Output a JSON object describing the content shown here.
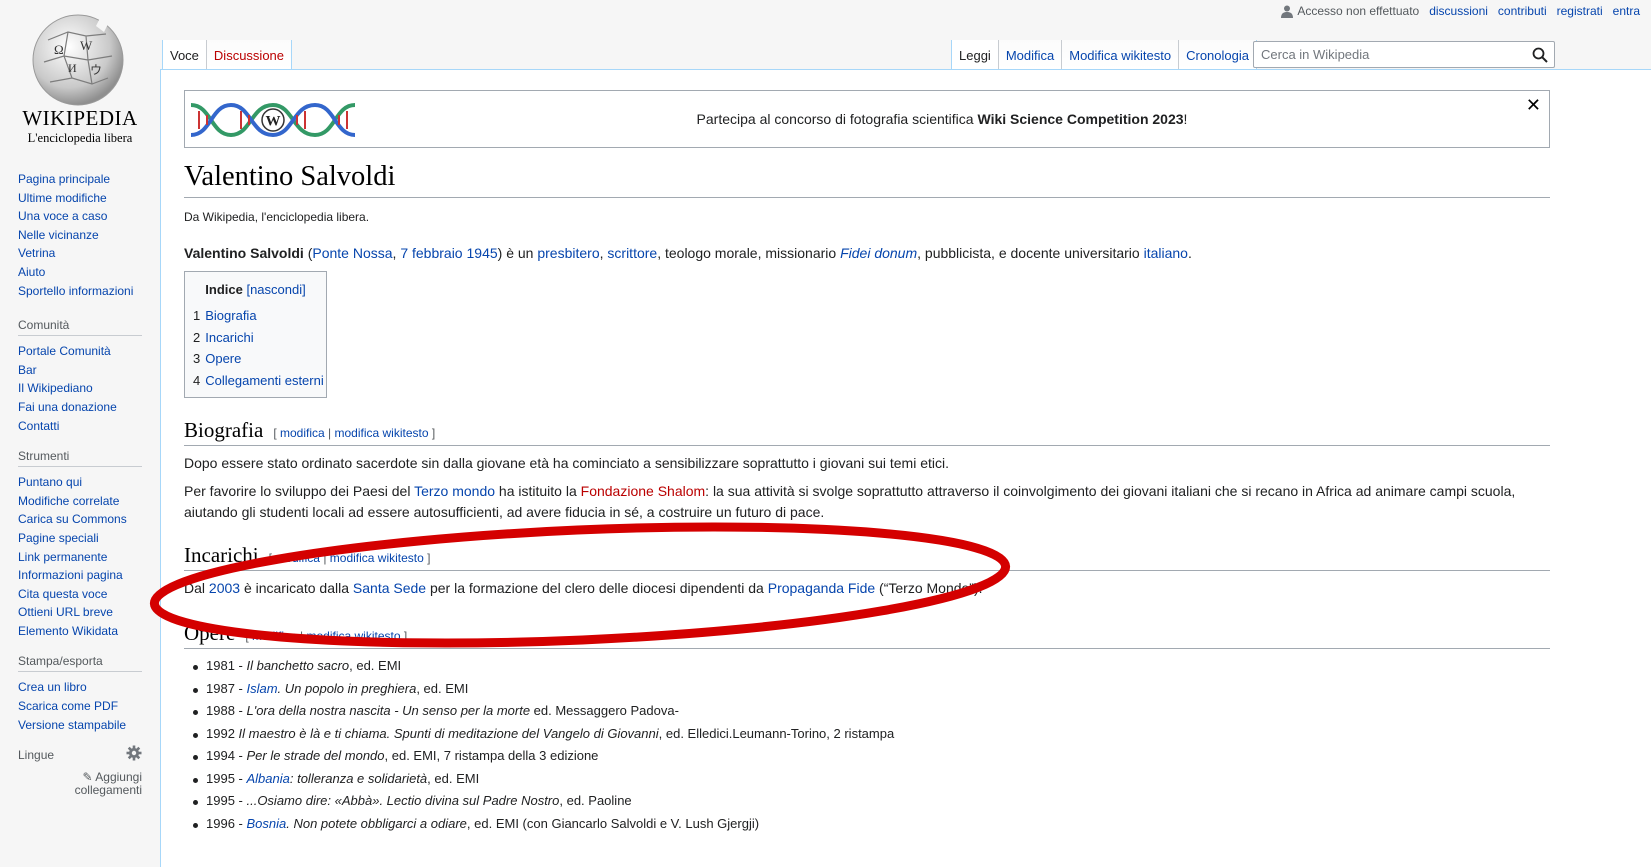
{
  "logo": {
    "wordmark": "WIKIPEDIA",
    "tagline": "L'enciclopedia libera"
  },
  "personal": {
    "anon": "Accesso non effettuato",
    "links": [
      "discussioni",
      "contributi",
      "registrati",
      "entra"
    ]
  },
  "tabs": {
    "left": [
      "Voce",
      "Discussione"
    ],
    "right": [
      "Leggi",
      "Modifica",
      "Modifica wikitesto",
      "Cronologia"
    ]
  },
  "search": {
    "placeholder": "Cerca in Wikipedia"
  },
  "sidebar": {
    "nav": [
      "Pagina principale",
      "Ultime modifiche",
      "Una voce a caso",
      "Nelle vicinanze",
      "Vetrina",
      "Aiuto",
      "Sportello informazioni"
    ],
    "community": {
      "heading": "Comunità",
      "items": [
        "Portale Comunità",
        "Bar",
        "Il Wikipediano",
        "Fai una donazione",
        "Contatti"
      ]
    },
    "tools": {
      "heading": "Strumenti",
      "items": [
        "Puntano qui",
        "Modifiche correlate",
        "Carica su Commons",
        "Pagine speciali",
        "Link permanente",
        "Informazioni pagina",
        "Cita questa voce",
        "Ottieni URL breve",
        "Elemento Wikidata"
      ]
    },
    "print": {
      "heading": "Stampa/esporta",
      "items": [
        "Crea un libro",
        "Scarica come PDF",
        "Versione stampabile"
      ]
    },
    "languages": {
      "heading": "Lingue",
      "add_links_1": "Aggiungi",
      "add_links_2": "collegamenti"
    }
  },
  "banner": {
    "text": "Partecipa al concorso di fotografia scientifica ",
    "bold": "Wiki Science Competition 2023",
    "after": "!",
    "close": "✕"
  },
  "article": {
    "title": "Valentino Salvoldi",
    "site_sub": "Da Wikipedia, l'enciclopedia libera.",
    "intro": {
      "subject": "Valentino Salvoldi",
      "open_paren": " (",
      "place": "Ponte Nossa",
      "sep": ", ",
      "date": "7 febbraio",
      "space": " ",
      "year": "1945",
      "t1": ") è un ",
      "presbitero": "presbitero",
      "comma": ", ",
      "scrittore": "scrittore",
      "t2": ", teologo morale, missionario ",
      "fidei": "Fidei donum",
      "t3": ", pubblicista, e docente universitario ",
      "italiano": "italiano",
      "t4": "."
    },
    "toc": {
      "title": "Indice",
      "toggle": "[nascondi]",
      "items": [
        {
          "num": "1",
          "label": "Biografia"
        },
        {
          "num": "2",
          "label": "Incarichi"
        },
        {
          "num": "3",
          "label": "Opere"
        },
        {
          "num": "4",
          "label": "Collegamenti esterni"
        }
      ]
    },
    "edit": {
      "open": "[ ",
      "modifica": "modifica",
      "sep": " | ",
      "wikitesto": "modifica wikitesto",
      "close": " ]"
    },
    "sections": {
      "biografia": {
        "title": "Biografia",
        "p1": "Dopo essere stato ordinato sacerdote sin dalla giovane età ha cominciato a sensibilizzare soprattutto i giovani sui temi etici.",
        "p2a": "Per favorire lo sviluppo dei Paesi del ",
        "terzo_mondo": "Terzo mondo",
        "p2b": " ha istituito la ",
        "fondazione": "Fondazione Shalom",
        "p2c": ": la sua attività si svolge soprattutto attraverso il coinvolgimento dei giovani italiani che si recano in Africa ad animare campi scuola, aiutando gli studenti locali ad essere autosufficienti, ad avere fiducia in sé, a costruire un futuro di pace."
      },
      "incarichi": {
        "title": "Incarichi",
        "a": "Dal ",
        "year": "2003",
        "b": " è incaricato dalla ",
        "santa_sede": "Santa Sede",
        "c": " per la formazione del clero delle diocesi dipendenti da ",
        "propaganda": "Propaganda Fide",
        "d": " (“Terzo Mondo”)."
      },
      "opere": {
        "title": "Opere",
        "items": [
          {
            "pre": "1981 - ",
            "link": "",
            "ital": "Il banchetto sacro",
            "post": ", ed. EMI"
          },
          {
            "pre": "1987 - ",
            "link": "Islam",
            "ital": ". Un popolo in preghiera",
            "post": ", ed. EMI"
          },
          {
            "pre": "1988 - ",
            "link": "",
            "ital": "L'ora della nostra nascita - Un senso per la morte",
            "post": " ed. Messaggero Padova-"
          },
          {
            "pre": "1992 ",
            "link": "",
            "ital": "Il maestro è là e ti chiama. Spunti di meditazione del Vangelo di Giovanni",
            "post": ", ed. Elledici.Leumann-Torino, 2 ristampa"
          },
          {
            "pre": "1994 - ",
            "link": "",
            "ital": "Per le strade del mondo",
            "post": ", ed. EMI, 7 ristampa della 3 edizione"
          },
          {
            "pre": "1995 - ",
            "link": "Albania",
            "ital": ": tolleranza e solidarietà",
            "post": ", ed. EMI"
          },
          {
            "pre": "1995 - ",
            "link": "",
            "ital": "...Osiamo dire: «Abbà». Lectio divina sul Padre Nostro",
            "post": ", ed. Paoline"
          },
          {
            "pre": "1996 - ",
            "link": "Bosnia",
            "ital": ". Non potete obbligarci a odiare",
            "post": ", ed. EMI (con Giancarlo Salvoldi e V. Lush Gjergji)"
          }
        ]
      }
    }
  },
  "colors": {
    "annotation": "#d40000",
    "link": "#0645ad",
    "redlink": "#ba0000"
  }
}
